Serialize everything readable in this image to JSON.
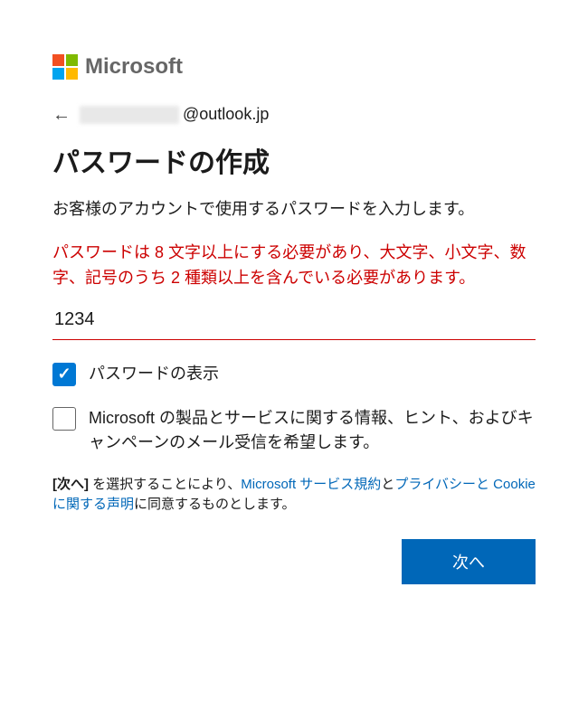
{
  "brand": {
    "name": "Microsoft"
  },
  "identity": {
    "email_suffix": "@outlook.jp"
  },
  "page": {
    "title": "パスワードの作成",
    "description": "お客様のアカウントで使用するパスワードを入力します。",
    "error": "パスワードは 8 文字以上にする必要があり、大文字、小文字、数字、記号のうち 2 種類以上を含んでいる必要があります。"
  },
  "password": {
    "value": "1234"
  },
  "options": {
    "show_password_label": "パスワードの表示",
    "show_password_checked": true,
    "marketing_label": "Microsoft の製品とサービスに関する情報、ヒント、およびキャンペーンのメール受信を希望します。",
    "marketing_checked": false
  },
  "consent": {
    "prefix_bold": "[次へ]",
    "text1": " を選択することにより、",
    "link1": "Microsoft サービス規約",
    "text2": "と",
    "link2": "プライバシーと Cookie に関する声明",
    "text3": "に同意するものとします。"
  },
  "buttons": {
    "next": "次へ"
  }
}
